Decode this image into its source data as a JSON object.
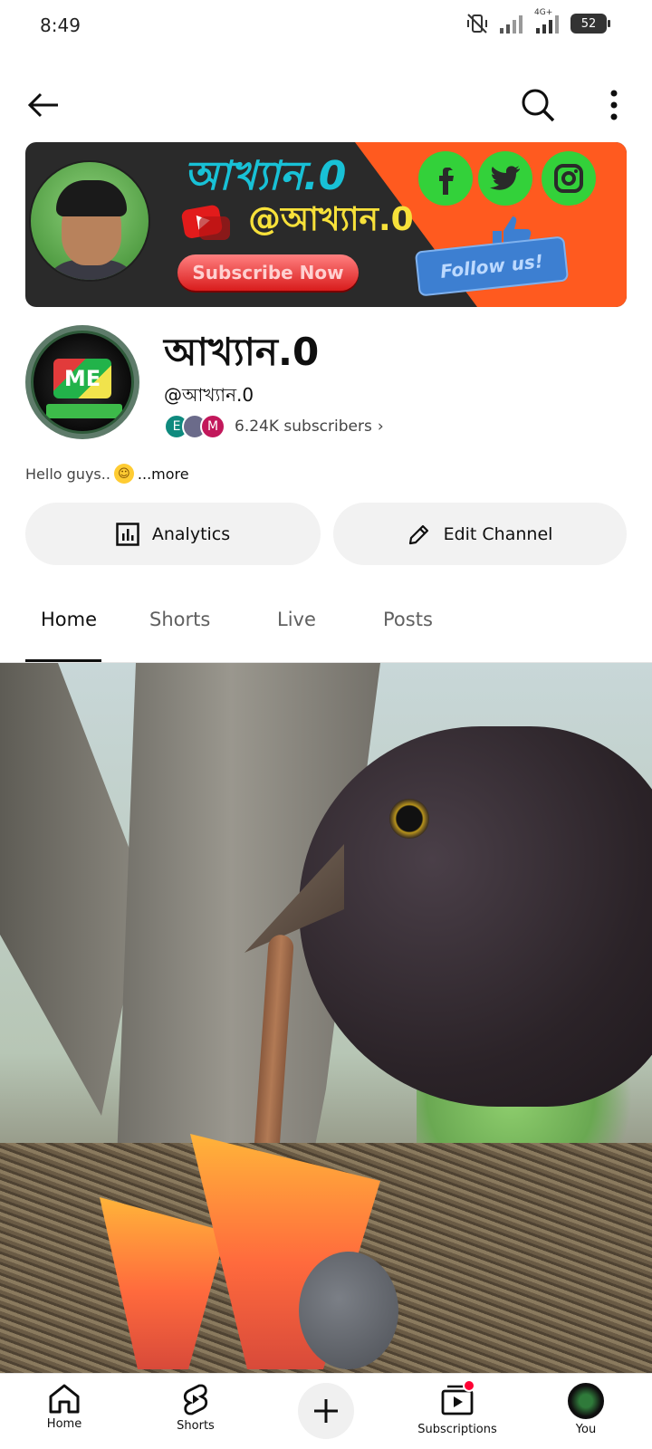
{
  "status_bar": {
    "time": "8:49",
    "network": "4G+",
    "battery": "52"
  },
  "top_bar": {
    "back_icon": "arrow-left-icon",
    "search_icon": "search-icon",
    "more_icon": "more-vertical-icon"
  },
  "banner": {
    "title": "আখ্যান.0",
    "handle": "@আখ্যান.0",
    "subscribe_label": "Subscribe Now",
    "follow_label": "Follow us!"
  },
  "channel": {
    "name": "আখ্যান.0",
    "handle": "@আখ্যান.0",
    "subscribers": "6.24K subscribers",
    "subscriber_avatars": [
      "E",
      "",
      "M"
    ],
    "bio": "Hello guys..",
    "bio_more": "...more"
  },
  "actions": {
    "analytics_label": "Analytics",
    "edit_label": "Edit Channel"
  },
  "tabs": [
    {
      "label": "Home",
      "active": true
    },
    {
      "label": "Shorts",
      "active": false
    },
    {
      "label": "Live",
      "active": false
    },
    {
      "label": "Posts",
      "active": false
    }
  ],
  "bottom_nav": {
    "home": "Home",
    "shorts": "Shorts",
    "subscriptions": "Subscriptions",
    "you": "You"
  },
  "colors": {
    "accent": "#0f0f0f",
    "notification": "#ff0033",
    "banner_orange": "#ff5a1f",
    "banner_cyan": "#18c1d6",
    "banner_yellow": "#f7e13a",
    "social_green": "#33d13a"
  }
}
